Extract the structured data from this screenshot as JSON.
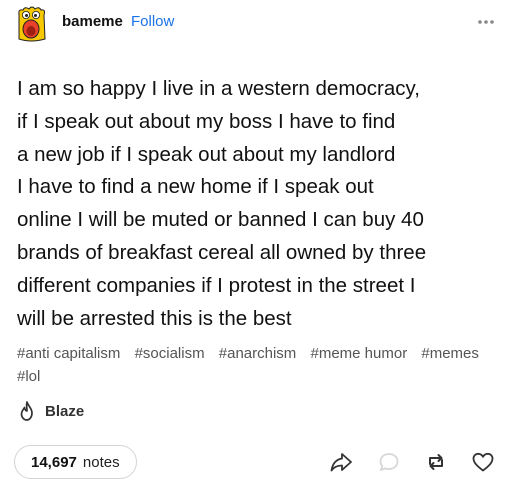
{
  "post": {
    "username": "bameme",
    "follow_label": "Follow",
    "avatar_icon": "yellow-monster-avatar",
    "more_icon": "more-options-icon",
    "body": "I am so happy I live in a western democracy,\nif I speak out about my boss I have to find\na new job if I speak out about my landlord\nI have to find a new home if I speak out\nonline I will be muted or banned I can buy 40\nbrands of breakfast cereal all owned by three\ndifferent companies if I protest in the street I\nwill be arrested this is the best",
    "tags": [
      "#anti capitalism",
      "#socialism",
      "#anarchism",
      "#meme humor",
      "#memes",
      "#lol"
    ],
    "blaze_label": "Blaze"
  },
  "footer": {
    "notes_count": "14,697",
    "notes_label": "notes",
    "actions": [
      "share-icon",
      "reply-icon",
      "reblog-icon",
      "like-icon"
    ]
  },
  "colors": {
    "accent": "#1a73e8",
    "avatar_yellow": "#f5c800",
    "avatar_red": "#e8422c"
  }
}
